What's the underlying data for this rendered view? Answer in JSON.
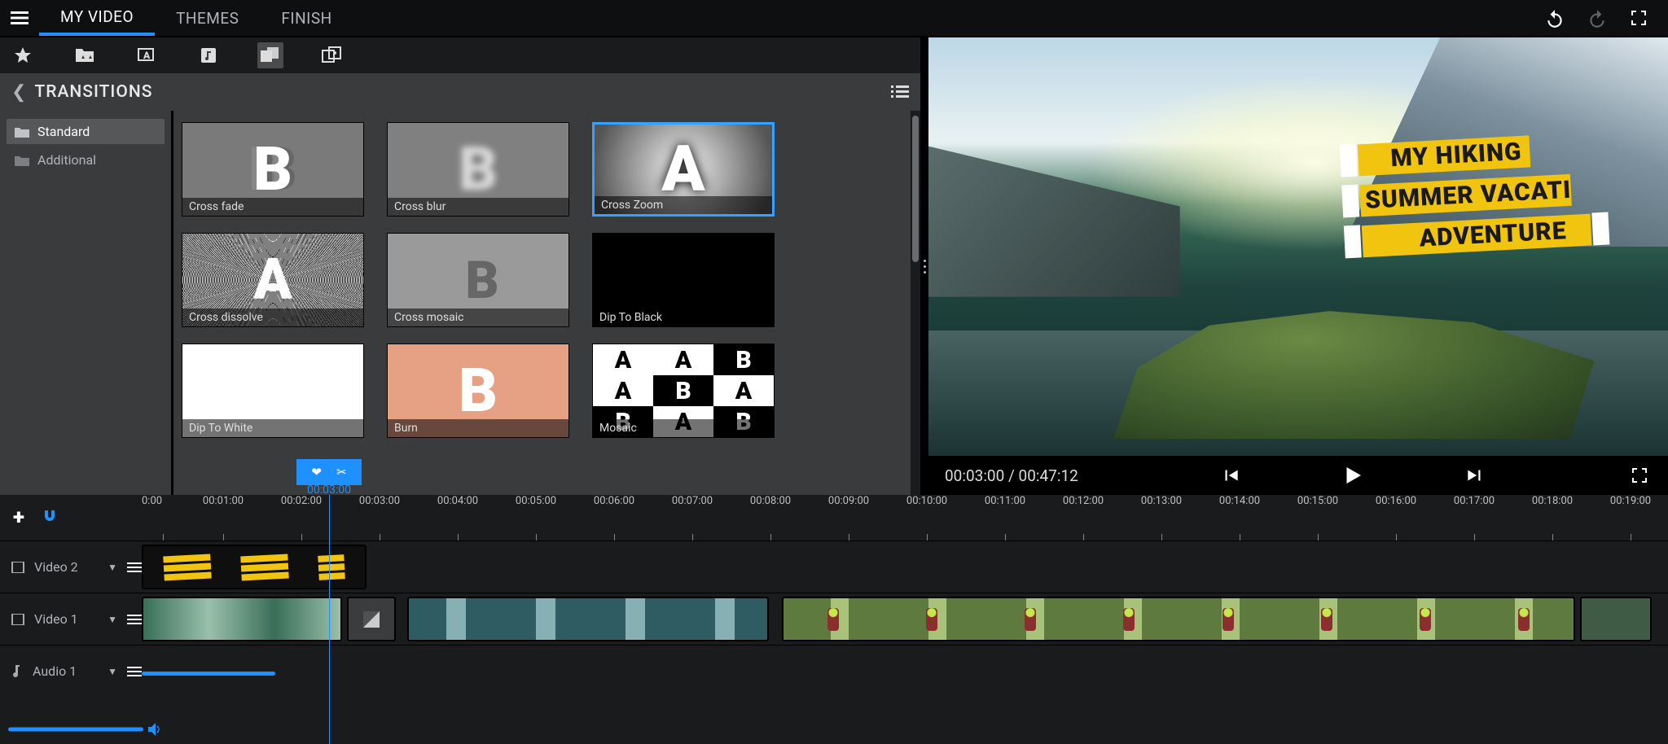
{
  "menu": {
    "tabs": [
      "MY VIDEO",
      "THEMES",
      "FINISH"
    ],
    "active": 0
  },
  "library": {
    "title": "TRANSITIONS",
    "categories": [
      {
        "label": "Standard",
        "selected": true
      },
      {
        "label": "Additional",
        "selected": false
      }
    ],
    "items": [
      {
        "label": "Cross fade",
        "art": "softB"
      },
      {
        "label": "Cross blur",
        "art": "blurB"
      },
      {
        "label": "Cross Zoom",
        "art": "bigA",
        "selected": true
      },
      {
        "label": "Cross dissolve",
        "art": "noise"
      },
      {
        "label": "Cross mosaic",
        "art": "mosaicA"
      },
      {
        "label": "Dip To Black",
        "art": "black"
      },
      {
        "label": "Dip To White",
        "art": "white"
      },
      {
        "label": "Burn",
        "art": "peach"
      },
      {
        "label": "Mosaic",
        "art": "mosgrid"
      }
    ]
  },
  "preview": {
    "title_lines": [
      "MY HIKING",
      "SUMMER VACATI",
      "ADVENTURE"
    ],
    "current_time": "00:03:00",
    "total_time": "00:47:12",
    "time_sep": " / "
  },
  "timeline": {
    "playhead_time": "00:03:00",
    "ticks": [
      "0:00",
      "00:01:00",
      "00:02:00",
      "00:03:00",
      "00:04:00",
      "00:05:00",
      "00:06:00",
      "00:07:00",
      "00:08:00",
      "00:09:00",
      "00:10:00",
      "00:11:00",
      "00:12:00",
      "00:13:00",
      "00:14:00",
      "00:15:00",
      "00:16:00",
      "00:17:00",
      "00:18:00",
      "00:19:00"
    ],
    "tracks": {
      "video2": "Video 2",
      "video1": "Video 1",
      "audio1": "Audio 1"
    }
  }
}
